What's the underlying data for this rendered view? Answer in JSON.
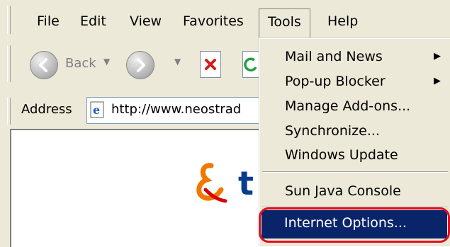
{
  "menubar": {
    "items": [
      {
        "label": "File"
      },
      {
        "label": "Edit"
      },
      {
        "label": "View"
      },
      {
        "label": "Favorites"
      },
      {
        "label": "Tools"
      },
      {
        "label": "Help"
      }
    ]
  },
  "toolbar": {
    "back_label": "Back"
  },
  "address": {
    "label": "Address",
    "url": "http://www.neostrad"
  },
  "tools_menu": {
    "items": [
      {
        "label": "Mail and News",
        "submenu": true
      },
      {
        "label": "Pop-up Blocker",
        "submenu": true
      },
      {
        "label": "Manage Add-ons...",
        "submenu": false
      },
      {
        "label": "Synchronize...",
        "submenu": false
      },
      {
        "label": "Windows Update",
        "submenu": false
      },
      {
        "label": "Sun Java Console",
        "submenu": false
      },
      {
        "label": "Internet Options...",
        "submenu": false,
        "selected": true
      }
    ]
  },
  "colors": {
    "menu_bg": "#ece9d8",
    "highlight": "#0a246a",
    "annotation_ring": "#e01020",
    "logo_orange": "#f07800",
    "logo_red": "#d80000",
    "logo_blue": "#0a3c8c"
  },
  "logo": {
    "text": "t"
  }
}
